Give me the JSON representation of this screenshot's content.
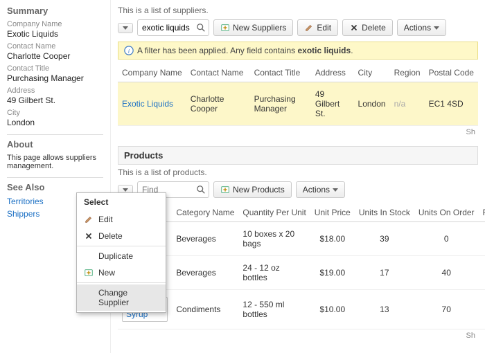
{
  "sidebar": {
    "summary_heading": "Summary",
    "fields": {
      "company_label": "Company Name",
      "company_value": "Exotic Liquids",
      "contact_name_label": "Contact Name",
      "contact_name_value": "Charlotte Cooper",
      "contact_title_label": "Contact Title",
      "contact_title_value": "Purchasing Manager",
      "address_label": "Address",
      "address_value": "49 Gilbert St.",
      "city_label": "City",
      "city_value": "London"
    },
    "about_heading": "About",
    "about_text": "This page allows suppliers management.",
    "see_also_heading": "See Also",
    "see_also": {
      "territories": "Territories",
      "shippers": "Shippers"
    }
  },
  "suppliers": {
    "description": "This is a list of suppliers.",
    "search_value": "exotic liquids",
    "buttons": {
      "new": "New Suppliers",
      "edit": "Edit",
      "delete": "Delete",
      "actions": "Actions"
    },
    "filter_notice_prefix": "A filter has been applied. Any field contains ",
    "filter_term": "exotic liquids",
    "columns": {
      "company": "Company Name",
      "contact_name": "Contact Name",
      "contact_title": "Contact Title",
      "address": "Address",
      "city": "City",
      "region": "Region",
      "postal": "Postal Code"
    },
    "row": {
      "company": "Exotic Liquids",
      "contact_name": "Charlotte Cooper",
      "contact_title": "Purchasing Manager",
      "address": "49 Gilbert St.",
      "city": "London",
      "region": "n/a",
      "postal": "EC1 4SD"
    },
    "scroll_hint": "Sh"
  },
  "products": {
    "heading": "Products",
    "description": "This is a list of products.",
    "search_placeholder": "Find",
    "buttons": {
      "new": "New Products",
      "actions": "Actions"
    },
    "columns": {
      "category": "Category Name",
      "qty": "Quantity Per Unit",
      "price": "Unit Price",
      "stock": "Units In Stock",
      "order": "Units On Order",
      "re": "Re"
    },
    "rows": [
      {
        "category": "Beverages",
        "qty": "10 boxes x 20 bags",
        "price": "$18.00",
        "stock": "39",
        "order": "0"
      },
      {
        "category": "Beverages",
        "qty": "24 - 12 oz bottles",
        "price": "$19.00",
        "stock": "17",
        "order": "40"
      },
      {
        "product": "Aniseed Syrup",
        "category": "Condiments",
        "qty": "12 - 550 ml bottles",
        "price": "$10.00",
        "stock": "13",
        "order": "70"
      }
    ],
    "scroll_hint": "Sh"
  },
  "context_menu": {
    "title": "Select",
    "edit": "Edit",
    "delete": "Delete",
    "duplicate": "Duplicate",
    "new": "New",
    "change_supplier": "Change Supplier"
  }
}
